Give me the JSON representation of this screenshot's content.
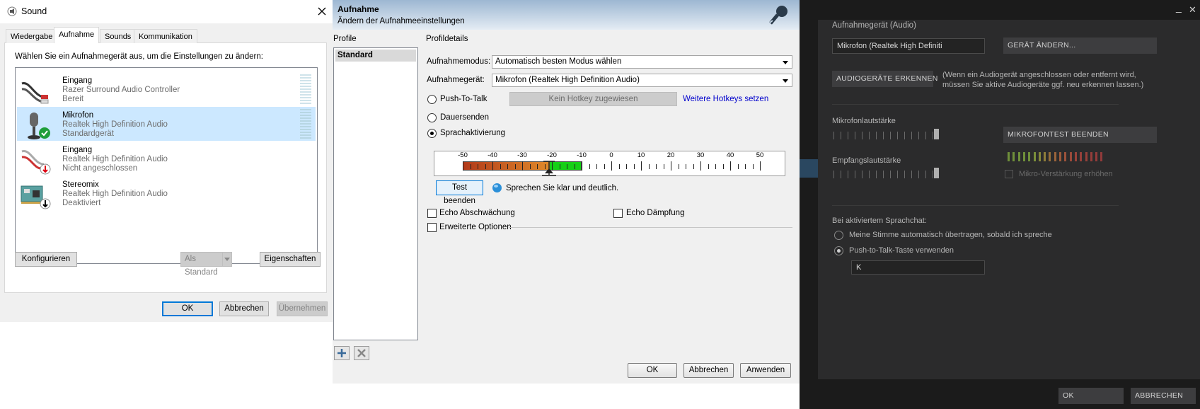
{
  "sound": {
    "title": "Sound",
    "tabs": [
      "Wiedergabe",
      "Aufnahme",
      "Sounds",
      "Kommunikation"
    ],
    "active_tab": "Aufnahme",
    "instruction": "Wählen Sie ein Aufnahmegerät aus, um die Einstellungen zu ändern:",
    "devices": [
      {
        "name": "Eingang",
        "driver": "Razer Surround Audio Controller",
        "status": "Bereit",
        "icon": "cable-jack-icon"
      },
      {
        "name": "Mikrofon",
        "driver": "Realtek High Definition Audio",
        "status": "Standardgerät",
        "icon": "microphone-icon",
        "selected": true
      },
      {
        "name": "Eingang",
        "driver": "Realtek High Definition Audio",
        "status": "Nicht angeschlossen",
        "icon": "cable-jack-icon"
      },
      {
        "name": "Stereomix",
        "driver": "Realtek High Definition Audio",
        "status": "Deaktiviert",
        "icon": "sound-card-icon"
      }
    ],
    "buttons": {
      "configure": "Konfigurieren",
      "set_default": "Als Standard",
      "properties": "Eigenschaften",
      "ok": "OK",
      "cancel": "Abbrechen",
      "apply": "Übernehmen"
    }
  },
  "aufnahme": {
    "title": "Aufnahme",
    "subtitle": "Ändern der Aufnahmeeinstellungen",
    "profiles_label": "Profile",
    "profiles": [
      "Standard"
    ],
    "details_label": "Profildetails",
    "mode_label": "Aufnahmemodus:",
    "mode_value": "Automatisch besten Modus wählen",
    "device_label": "Aufnahmegerät:",
    "device_value": "Mikrofon (Realtek High Definition Audio)",
    "ptt_label": "Push-To-Talk",
    "hotkey_button": "Kein Hotkey zugewiesen",
    "more_hotkeys": "Weitere Hotkeys setzen",
    "continuous_label": "Dauersenden",
    "voice_label": "Sprachaktivierung",
    "selected_mode": "Sprachaktivierung",
    "scale_labels": [
      "-50",
      "-40",
      "-30",
      "-20",
      "-10",
      "0",
      "10",
      "20",
      "30",
      "40",
      "50"
    ],
    "test_button": "Test beenden",
    "test_hint": "Sprechen Sie klar und deutlich.",
    "echo_reduction": "Echo Abschwächung",
    "echo_damping": "Echo Dämpfung",
    "advanced": "Erweiterte Optionen",
    "buttons": {
      "ok": "OK",
      "cancel": "Abbrechen",
      "apply": "Anwenden"
    },
    "level_meter": {
      "min": -50,
      "max": 50,
      "level": -10,
      "threshold": -21
    }
  },
  "steam": {
    "close_glyph": "✕",
    "minimize_glyph": "_",
    "device_section": "Aufnahmegerät (Audio)",
    "device_value": "Mikrofon (Realtek High Definiti",
    "change_device": "GERÄT ÄNDERN...",
    "detect_devices": "AUDIOGERÄTE ERKENNEN",
    "detect_hint_1": "(Wenn ein Audiogerät angeschlossen oder entfernt wird,",
    "detect_hint_2": "müssen Sie aktive Audiogeräte ggf. neu erkennen lassen.)",
    "mic_volume": "Mikrofonlautstärke",
    "mic_test": "MIKROFONTEST BEENDEN",
    "receive_volume": "Empfangslautstärke",
    "mic_boost": "Mikro-Verstärkung erhöhen",
    "voice_chat_label": "Bei aktiviertem Sprachchat:",
    "auto_transmit": "Meine Stimme automatisch übertragen, sobald ich spreche",
    "use_ptt": "Push-to-Talk-Taste verwenden",
    "ptt_key": "K",
    "ok": "OK",
    "cancel": "ABBRECHEN",
    "mic_volume_level": 1.0,
    "receive_volume_level": 1.0
  }
}
